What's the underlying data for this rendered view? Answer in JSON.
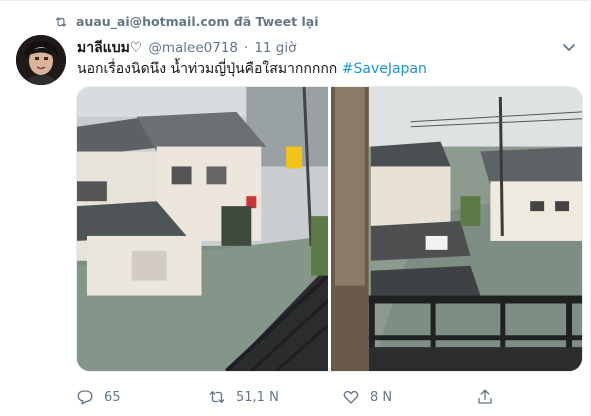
{
  "retweet_context": {
    "icon": "retweet-icon",
    "text": "auau_ai@hotmail.com đã Tweet lại"
  },
  "tweet": {
    "display_name": "มาลีแบม♡",
    "handle": "@malee0718",
    "separator": "·",
    "time": "11 giờ",
    "text_main": "นอกเรื่องนิดนึง น้ำท่วมญี่ปุ่นคือใสมากกกกก",
    "hashtag": "#SaveJapan"
  },
  "actions": {
    "reply_count": "65",
    "retweet_count": "51,1 N",
    "like_count": "8 N",
    "icons": [
      "reply-icon",
      "retweet-icon",
      "like-icon",
      "share-icon"
    ]
  },
  "colors": {
    "accent": "#1b95e0",
    "muted": "#657786",
    "text": "#14171a"
  }
}
